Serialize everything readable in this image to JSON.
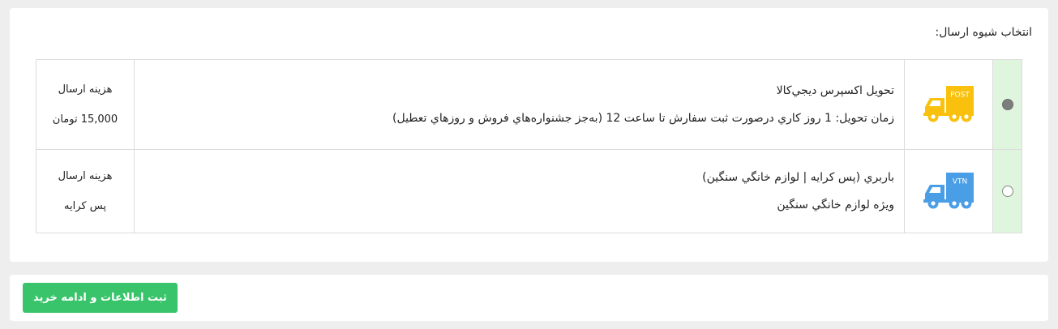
{
  "shipping": {
    "title": "انتخاب شیوه ارسال:",
    "options": [
      {
        "selected": true,
        "icon": "delivery-truck-icon",
        "icon_label": "POST",
        "icon_color": "#f9c10d",
        "name": "تحويل اكسپرس ديجي‌كالا",
        "detail": "زمان تحويل: 1 روز كاري درصورت ثبت سفارش تا ساعت 12 (به‌جز جشنواره‌هاي فروش و روزهاي تعطيل)",
        "cost_label": "هزينه ارسال",
        "cost_value": "15,000 تومان"
      },
      {
        "selected": false,
        "icon": "delivery-truck-icon",
        "icon_label": "VTN",
        "icon_color": "#4a9ee6",
        "name": "باربري (پس كرايه | لوازم خانگي سنگين)",
        "detail": "ويژه لوازم خانگي سنگين",
        "cost_label": "هزينه ارسال",
        "cost_value": "پس كرايه"
      }
    ]
  },
  "submit": {
    "label": "ثبت اطلاعات و ادامه خريد",
    "color": "#39c46b"
  }
}
